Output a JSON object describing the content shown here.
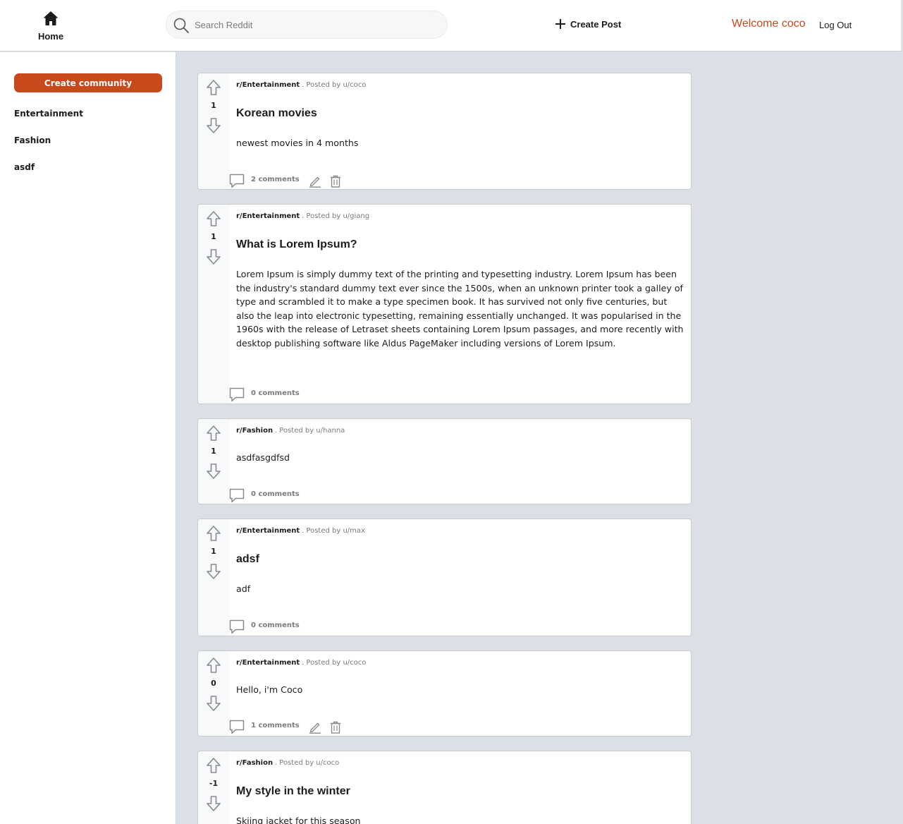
{
  "header": {
    "home_label": "Home",
    "search_placeholder": "Search Reddit",
    "create_post_label": "Create Post",
    "welcome_text": "Welcome coco",
    "logout_label": "Log Out"
  },
  "sidebar": {
    "create_community_label": "Create community",
    "items": [
      {
        "label": "Entertainment"
      },
      {
        "label": "Fashion"
      },
      {
        "label": "asdf"
      }
    ]
  },
  "posts": [
    {
      "score": "1",
      "subreddit": "r/Entertainment",
      "separator": ".",
      "posted_by": "Posted by u/coco",
      "title": "Korean movies",
      "body": "newest movies in 4 months",
      "comments": "2 comments"
    },
    {
      "score": "1",
      "subreddit": "r/Entertainment",
      "separator": ".",
      "posted_by": "Posted by u/giang",
      "title": "What is Lorem Ipsum?",
      "body": "Lorem Ipsum is simply dummy text of the printing and typesetting industry. Lorem Ipsum has been the industry's standard dummy text ever since the 1500s, when an unknown printer took a galley of type and scrambled it to make a type specimen book. It has survived not only five centuries, but also the leap into electronic typesetting, remaining essentially unchanged. It was popularised in the 1960s with the release of Letraset sheets containing Lorem Ipsum passages, and more recently with desktop publishing software like Aldus PageMaker including versions of Lorem Ipsum.",
      "comments": "0 comments"
    },
    {
      "score": "1",
      "subreddit": "r/Fashion",
      "separator": ".",
      "posted_by": "Posted by u/hanna",
      "title": "",
      "body": "asdfasgdfsd",
      "comments": "0 comments"
    },
    {
      "score": "1",
      "subreddit": "r/Entertainment",
      "separator": ".",
      "posted_by": "Posted by u/max",
      "title": "adsf",
      "body": "adf",
      "comments": "0 comments"
    },
    {
      "score": "0",
      "subreddit": "r/Entertainment",
      "separator": ".",
      "posted_by": "Posted by u/coco",
      "title": "",
      "body": "Hello, i'm Coco",
      "comments": "1 comments"
    },
    {
      "score": "-1",
      "subreddit": "r/Fashion",
      "separator": ".",
      "posted_by": "Posted by u/coco",
      "title": "My style in the winter",
      "body": "Skiing jacket for this season",
      "comments": ""
    }
  ],
  "colors": {
    "accent": "#c8491b",
    "page_bg": "#dae0e6"
  }
}
